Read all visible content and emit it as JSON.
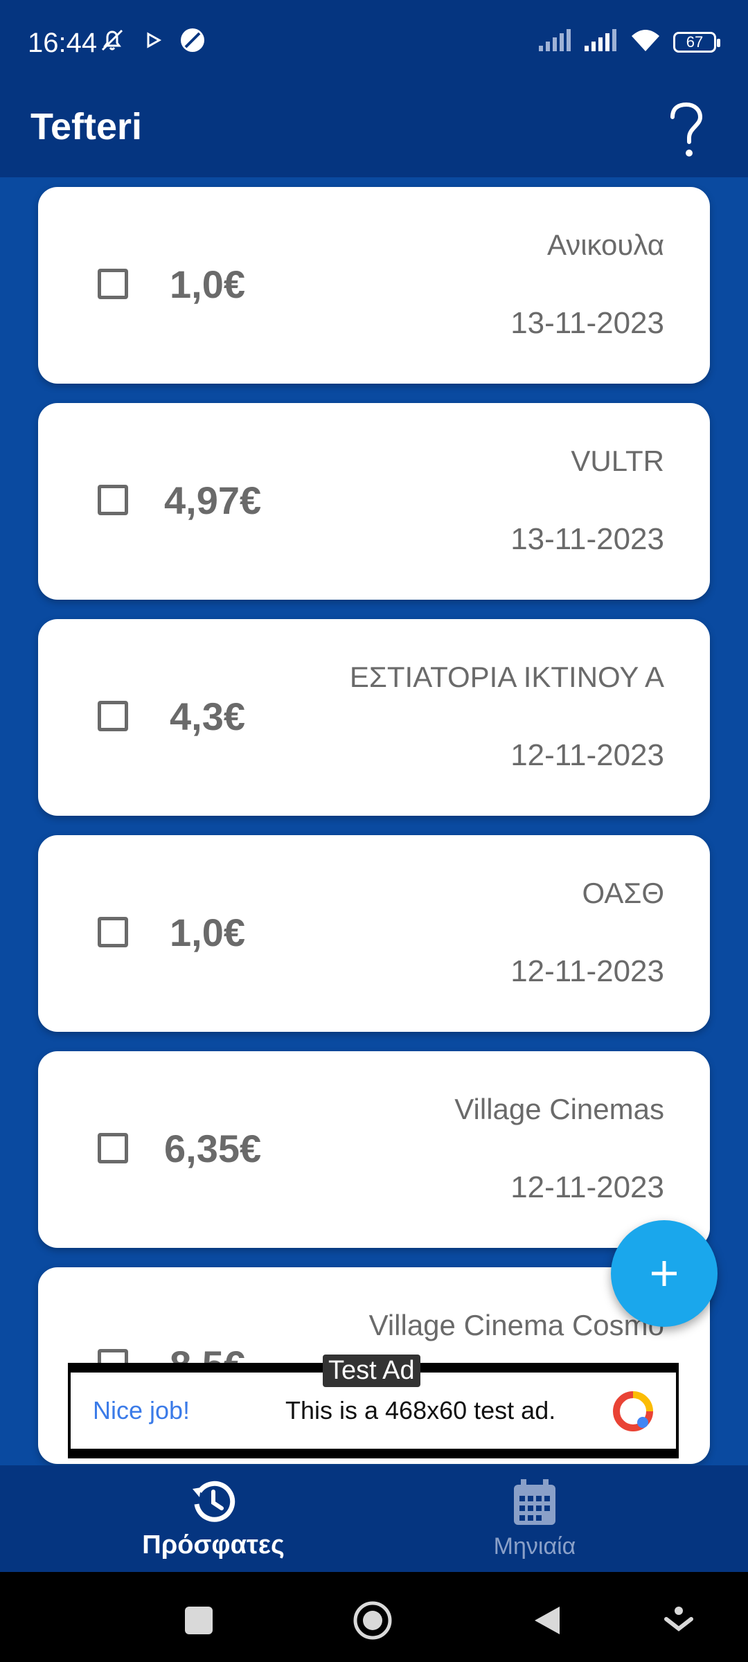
{
  "status": {
    "time": "16:44",
    "battery": "67"
  },
  "app": {
    "title": "Tefteri"
  },
  "entries": [
    {
      "amount": "1,0€",
      "name": "Ανικουλα",
      "date": "13-11-2023"
    },
    {
      "amount": "4,97€",
      "name": "VULTR",
      "date": "13-11-2023"
    },
    {
      "amount": "4,3€",
      "name": "ΕΣΤΙΑΤΟΡΙΑ ΙΚΤΙΝΟΥ Α",
      "date": "12-11-2023"
    },
    {
      "amount": "1,0€",
      "name": "ΟΑΣΘ",
      "date": "12-11-2023"
    },
    {
      "amount": "6,35€",
      "name": "Village Cinemas",
      "date": "12-11-2023"
    },
    {
      "amount": "8,5€",
      "name": "Village Cinema Cosmo",
      "date": ""
    }
  ],
  "ad": {
    "label": "Test Ad",
    "nice": "Nice job!",
    "text": "This is a 468x60 test ad."
  },
  "nav": {
    "recent_label": "Πρόσφατες",
    "monthly_label": "Μηνιαία"
  },
  "colors": {
    "background": "#0a4aa0",
    "bars": "#053580",
    "fab": "#1aa7ec",
    "text_gray": "#6a6a6a"
  }
}
